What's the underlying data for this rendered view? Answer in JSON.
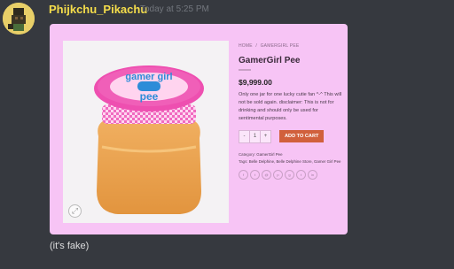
{
  "message": {
    "username": "Phijkchu_Pikachu",
    "timestamp": "Today at 5:25 PM",
    "caption": "(it's fake)"
  },
  "product": {
    "breadcrumb": [
      "HOME",
      "/",
      "GAMERGIRL PEE"
    ],
    "title": "GamerGirl Pee",
    "price": "$9,999.00",
    "description": "Only one jar for one lucky cutie fan ^-^ This will not be sold again. disclaimer: This is not for drinking and should only be used for sentimental purposes.",
    "quantity": "1",
    "qty_minus": "-",
    "qty_plus": "+",
    "add_to_cart": "ADD TO CART",
    "category_label": "Category:",
    "category_value": "GamerGirl Pee",
    "tags_label": "Tags:",
    "tags_value": "Belle Delphine, Belle Delphine Store, Gamer Girl Pee",
    "jar_lid_text_top": "gamer girl",
    "jar_lid_text_bottom": "pee",
    "share_icons": [
      "facebook-icon",
      "twitter-icon",
      "email-icon",
      "pinterest-icon",
      "google-plus-icon",
      "tumblr-icon",
      "linkedin-icon"
    ]
  },
  "colors": {
    "background": "#36393f",
    "username": "#f5dd4b",
    "embed": "#f7c4f5",
    "add_to_cart": "#d1603c"
  }
}
